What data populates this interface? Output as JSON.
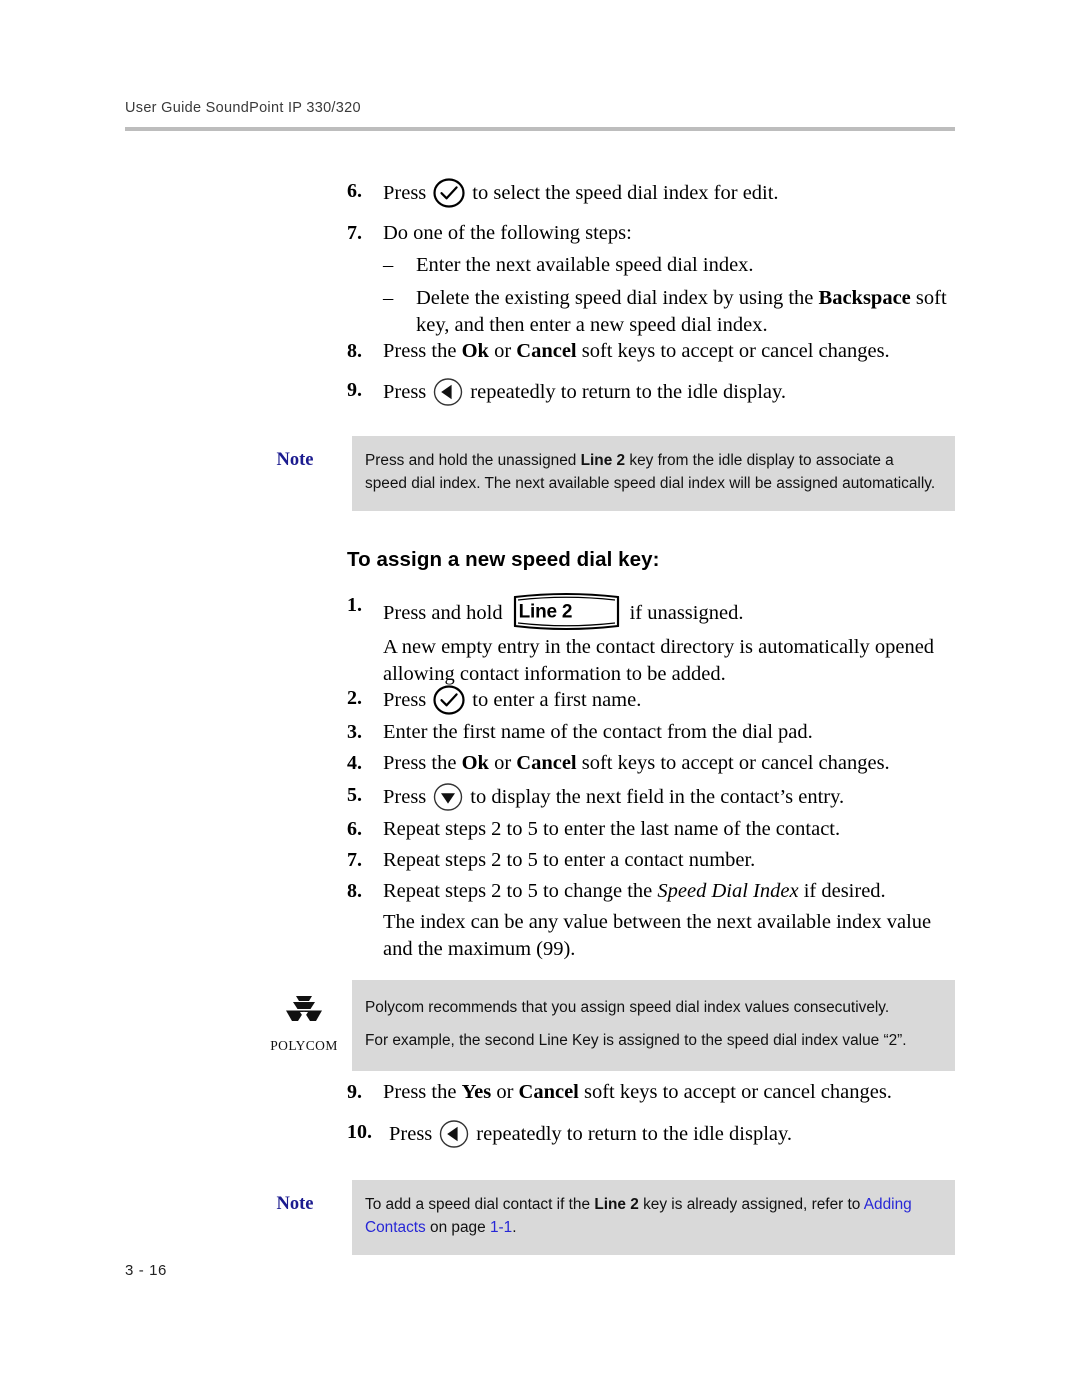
{
  "header": {
    "running_head": "User Guide SoundPoint IP 330/320"
  },
  "footer": {
    "page_number": "3 - 16"
  },
  "section_heading": "To assign a new speed dial key:",
  "icons": {
    "select_key": "checkmark-circle-icon",
    "back_key": "left-arrow-circle-icon",
    "down_key": "down-arrow-circle-icon",
    "line_key_label": "Line 2",
    "logo": "polycom-logo"
  },
  "steps_top": [
    {
      "num": "6.",
      "pre": "Press",
      "icon": "checkmark-circle-icon",
      "post": "to select the speed dial index for edit."
    },
    {
      "num": "7.",
      "text": "Do one of the following steps:"
    }
  ],
  "sub_items": [
    {
      "dash": "–",
      "text": "Enter the next available speed dial index."
    },
    {
      "dash": "–",
      "part1": "Delete the existing speed dial index by using the ",
      "bold": "Backspace",
      "part2": " soft key, and then enter a new speed dial index."
    }
  ],
  "steps_top_2": [
    {
      "num": "8.",
      "part1": "Press the ",
      "bold1": "Ok",
      "part2": " or ",
      "bold2": "Cancel",
      "part3": " soft keys to accept or cancel changes."
    },
    {
      "num": "9.",
      "pre": "Press",
      "icon": "left-arrow-circle-icon",
      "post": "repeatedly to return to the idle display."
    }
  ],
  "note_top": {
    "label": "Note",
    "part1": "Press and hold the unassigned ",
    "bold": "Line 2",
    "part2": " key from the idle display to associate a speed dial index. The next available speed dial index will be assigned automatically."
  },
  "steps_main": [
    {
      "num": "1.",
      "pre": "Press and hold",
      "key": "Line 2",
      "post": "if unassigned."
    },
    {
      "num": "",
      "para": "A new empty entry in the contact directory is automatically opened allowing contact information to be added."
    },
    {
      "num": "2.",
      "pre": "Press",
      "icon": "checkmark-circle-icon",
      "post": "to enter a first name."
    },
    {
      "num": "3.",
      "text": "Enter the first name of the contact from the dial pad."
    },
    {
      "num": "4.",
      "part1": "Press the ",
      "bold1": "Ok",
      "part2": " or ",
      "bold2": "Cancel",
      "part3": " soft keys to accept or cancel changes."
    },
    {
      "num": "5.",
      "pre": "Press",
      "icon": "down-arrow-circle-icon",
      "post": "to display the next field in the contact’s entry."
    },
    {
      "num": "6.",
      "text": "Repeat steps 2 to 5 to enter the last name of the contact."
    },
    {
      "num": "7.",
      "text": "Repeat steps 2 to 5 to enter a contact number."
    },
    {
      "num": "8.",
      "part1": "Repeat steps 2 to 5 to change the ",
      "italic": "Speed Dial Index",
      "part2": " if desired."
    },
    {
      "num": "",
      "para": "The index can be any value between the next available index value and the maximum (99)."
    }
  ],
  "tip_box": {
    "line1": "Polycom recommends that you assign speed dial index values consecutively.",
    "line2": "For example, the second Line Key is assigned to the speed dial index value “2”.",
    "logo_word": "POLYCOM"
  },
  "steps_end": [
    {
      "num": "9.",
      "part1": "Press the ",
      "bold1": "Yes",
      "part2": " or ",
      "bold2": "Cancel",
      "part3": " soft keys to accept or cancel changes."
    },
    {
      "num": "10.",
      "pre": "Press",
      "icon": "left-arrow-circle-icon",
      "post": "repeatedly to return to the idle display."
    }
  ],
  "note_bottom": {
    "label": "Note",
    "part1": "To add a speed dial contact if the ",
    "bold": "Line 2",
    "part2": " key is already assigned, refer to ",
    "link1": "Adding Contacts",
    "part3": " on page ",
    "link2": "1-1",
    "part4": "."
  },
  "colors": {
    "note_label": "#1b1b8f",
    "note_bg": "#d9d9d9",
    "link": "#2727d6",
    "rule": "#bdbdbd"
  }
}
